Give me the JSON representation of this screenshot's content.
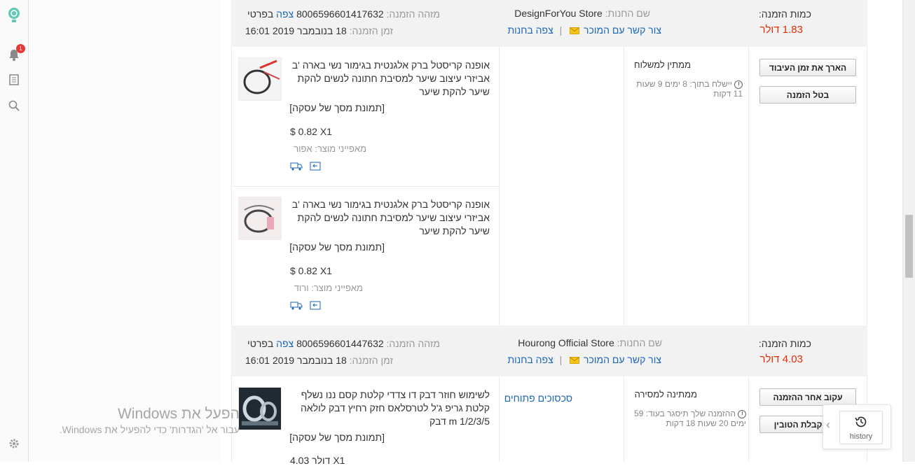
{
  "sidebar": {
    "notification_count": "1"
  },
  "labels": {
    "order_id": "מזהה הזמנה:",
    "view": "צפה",
    "details": "בפרטי",
    "order_time": "זמן הזמנה:",
    "store_name": "שם החנות:",
    "contact_seller": "צור קשר עם המוכר",
    "view_store": "צפה בחנות",
    "separator": "|",
    "order_amount": "כמות הזמנה:",
    "screenshot": "[תמונת מסך של עסקה]"
  },
  "orders": [
    {
      "order_id": "8006596601417632",
      "order_time": "18 בנובמבר 2019 16:01",
      "store": "DesignForYou Store",
      "amount": "1.83 דולר",
      "status": "ממתין למשלוח",
      "timer": "יישלח בתוך: 8 ימים 9 שעות 11 דקות",
      "buttons": [
        "הארך את זמן העיבוד",
        "בטל הזמנה"
      ],
      "products": [
        {
          "title": "אופנה קריסטל ברק אלגנטית בגימור נשי בארה 'ב אביזרי עיצוב שיער למסיבת חתונה לנשים להקת שיער להקת שיער",
          "price": "$ 0.82 X1",
          "attr": "מאפייני מוצר: אפור"
        },
        {
          "title": "אופנה קריסטל ברק אלגנטית בגימור נשי בארה 'ב אביזרי עיצוב שיער למסיבת חתונה לנשים להקת שיער להקת שיער",
          "price": "$ 0.82 X1",
          "attr": "מאפייני מוצר: ורוד"
        }
      ]
    },
    {
      "order_id": "8006596601447632",
      "order_time": "18 בנובמבר 2019 16:01",
      "store": "Hourong Official Store",
      "amount": "4.03 דולר",
      "status": "ממתינה למסירה",
      "timer": "ההזמנה שלך תיסגר בעוד: 59 ימים 20 שעות 18 דקות",
      "dispute": "סכסוכים פתוחים",
      "buttons": [
        "עקוב אחר ההזמנה",
        "אשר קבלת הטובין"
      ],
      "products": [
        {
          "title": "לשימוש חוזר דבק דו צדדי קלטת קסם ננו נשלף קלטת גריפ ג'ל לטרסלאס חזק רחיץ דבק לולאה 1/2/3/5 m דבק",
          "price": "4.03 דולר X1"
        }
      ]
    }
  ],
  "watermark": {
    "line1": "הפעל את Windows",
    "line2": "עבור אל 'הגדרות' כדי להפעיל את Windows."
  },
  "history": {
    "label": "history"
  }
}
